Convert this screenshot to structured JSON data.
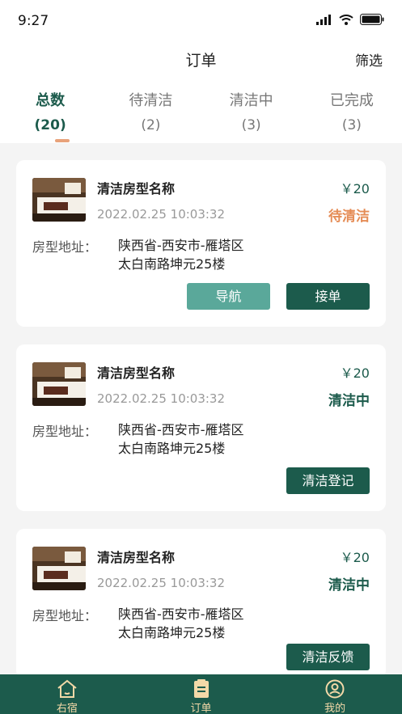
{
  "status_bar": {
    "time": "9:27"
  },
  "nav": {
    "title": "订单",
    "filter": "筛选"
  },
  "tabs": [
    {
      "label": "总数",
      "count": "(20)"
    },
    {
      "label": "待清洁",
      "count": "(2)"
    },
    {
      "label": "清洁中",
      "count": "(3)"
    },
    {
      "label": "已完成",
      "count": "(3)"
    }
  ],
  "orders": [
    {
      "name": "清洁房型名称",
      "date": "2022.02.25 10:03:32",
      "price": "￥20",
      "status": "待清洁",
      "status_color": "#e58c55",
      "address_label": "房型地址：",
      "address_line1": "陕西省-西安市-雁塔区",
      "address_line2": "太白南路坤元25楼",
      "buttons": [
        "导航",
        "接单"
      ]
    },
    {
      "name": "清洁房型名称",
      "date": "2022.02.25 10:03:32",
      "price": "￥20",
      "status": "清洁中",
      "status_color": "#1c5b4c",
      "address_label": "房型地址：",
      "address_line1": "陕西省-西安市-雁塔区",
      "address_line2": "太白南路坤元25楼",
      "buttons": [
        "清洁登记"
      ]
    },
    {
      "name": "清洁房型名称",
      "date": "2022.02.25 10:03:32",
      "price": "￥20",
      "status": "清洁中",
      "status_color": "#1c5b4c",
      "address_label": "房型地址：",
      "address_line1": "陕西省-西安市-雁塔区",
      "address_line2": "太白南路坤元25楼",
      "buttons": [
        "清洁反馈"
      ]
    }
  ],
  "tabbar": [
    {
      "label": "右宿",
      "icon": "home-icon"
    },
    {
      "label": "订单",
      "icon": "order-icon"
    },
    {
      "label": "我的",
      "icon": "profile-icon"
    }
  ],
  "colors": {
    "brand": "#1c5b4c",
    "accent": "#e58c55",
    "button_light": "#5aa89a",
    "tabbar_text": "#f3d9a8"
  }
}
